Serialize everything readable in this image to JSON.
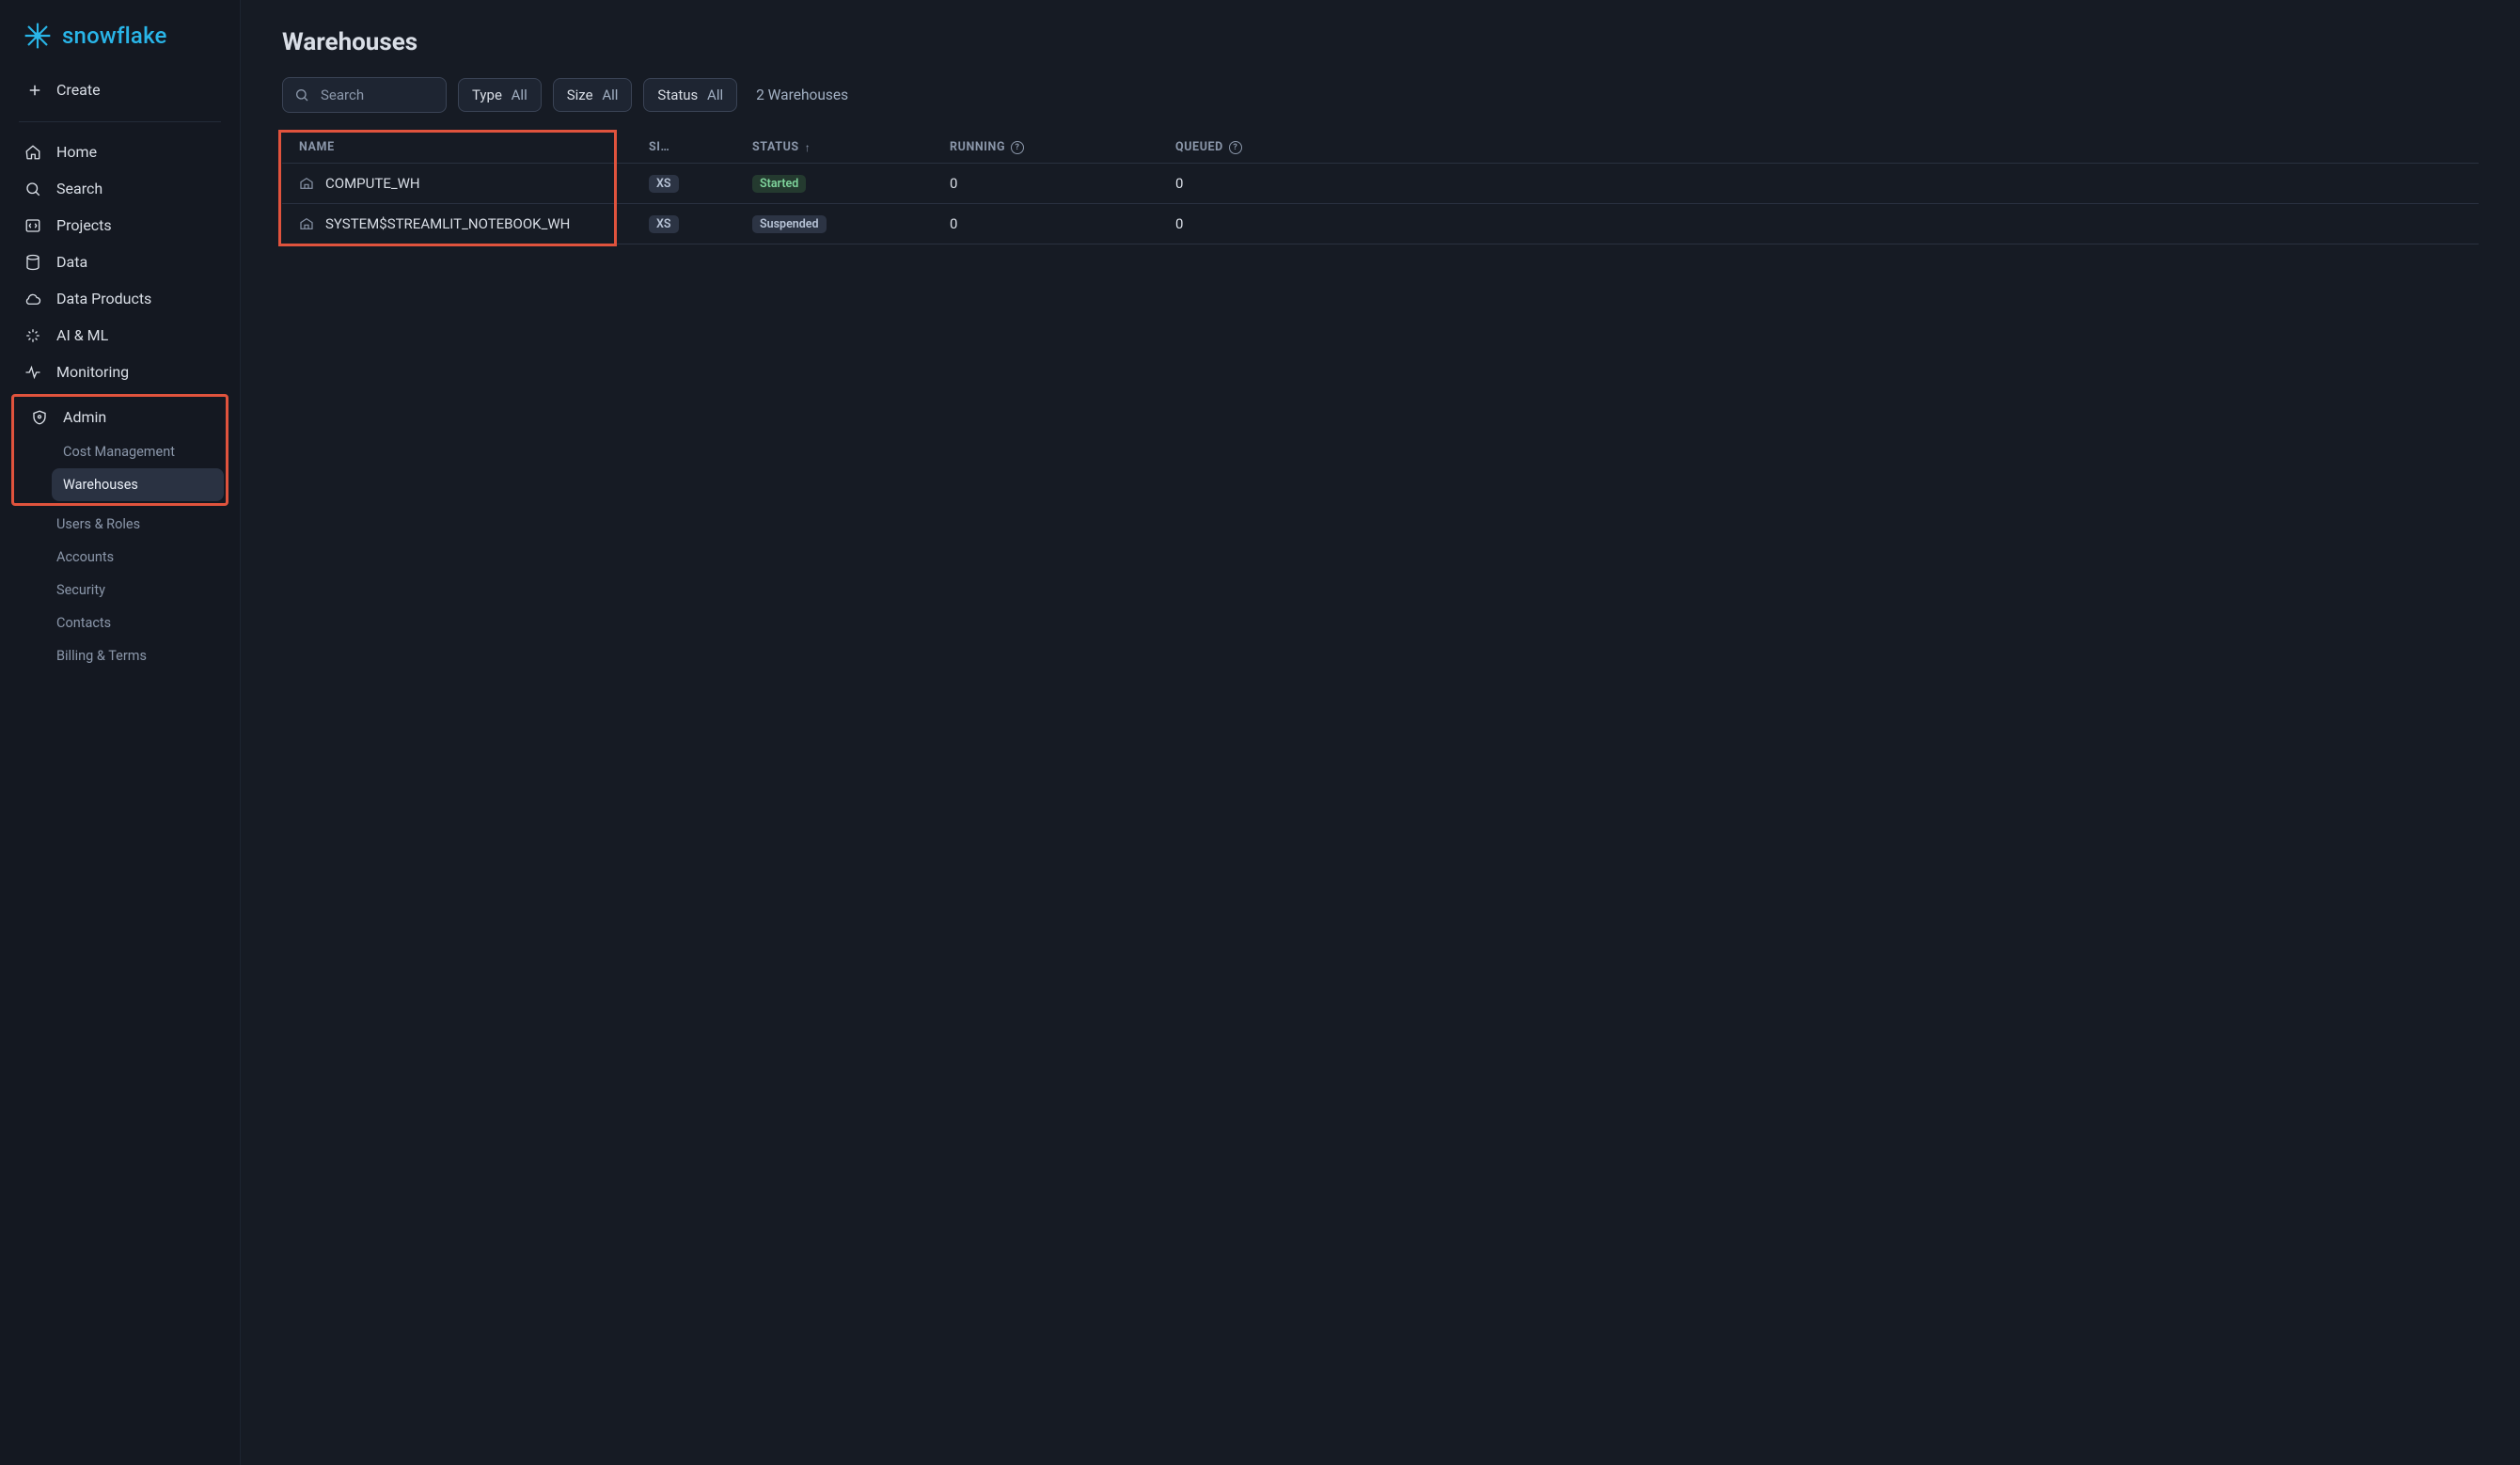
{
  "brand": {
    "name": "snowflake"
  },
  "create_label": "Create",
  "nav": {
    "home": "Home",
    "search": "Search",
    "projects": "Projects",
    "data": "Data",
    "data_products": "Data Products",
    "ai_ml": "AI & ML",
    "monitoring": "Monitoring",
    "admin": "Admin"
  },
  "admin_sub": {
    "cost": "Cost Management",
    "warehouses": "Warehouses",
    "users_roles": "Users & Roles",
    "accounts": "Accounts",
    "security": "Security",
    "contacts": "Contacts",
    "billing": "Billing & Terms"
  },
  "page_title": "Warehouses",
  "search": {
    "placeholder": "Search"
  },
  "filters": {
    "type_label": "Type",
    "type_value": "All",
    "size_label": "Size",
    "size_value": "All",
    "status_label": "Status",
    "status_value": "All"
  },
  "count_text": "2 Warehouses",
  "columns": {
    "name": "NAME",
    "size": "SI…",
    "status": "STATUS",
    "running": "RUNNING",
    "queued": "QUEUED"
  },
  "rows": [
    {
      "name": "COMPUTE_WH",
      "size": "XS",
      "status": "Started",
      "status_kind": "started",
      "running": "0",
      "queued": "0"
    },
    {
      "name": "SYSTEM$STREAMLIT_NOTEBOOK_WH",
      "size": "XS",
      "status": "Suspended",
      "status_kind": "suspended",
      "running": "0",
      "queued": "0"
    }
  ]
}
